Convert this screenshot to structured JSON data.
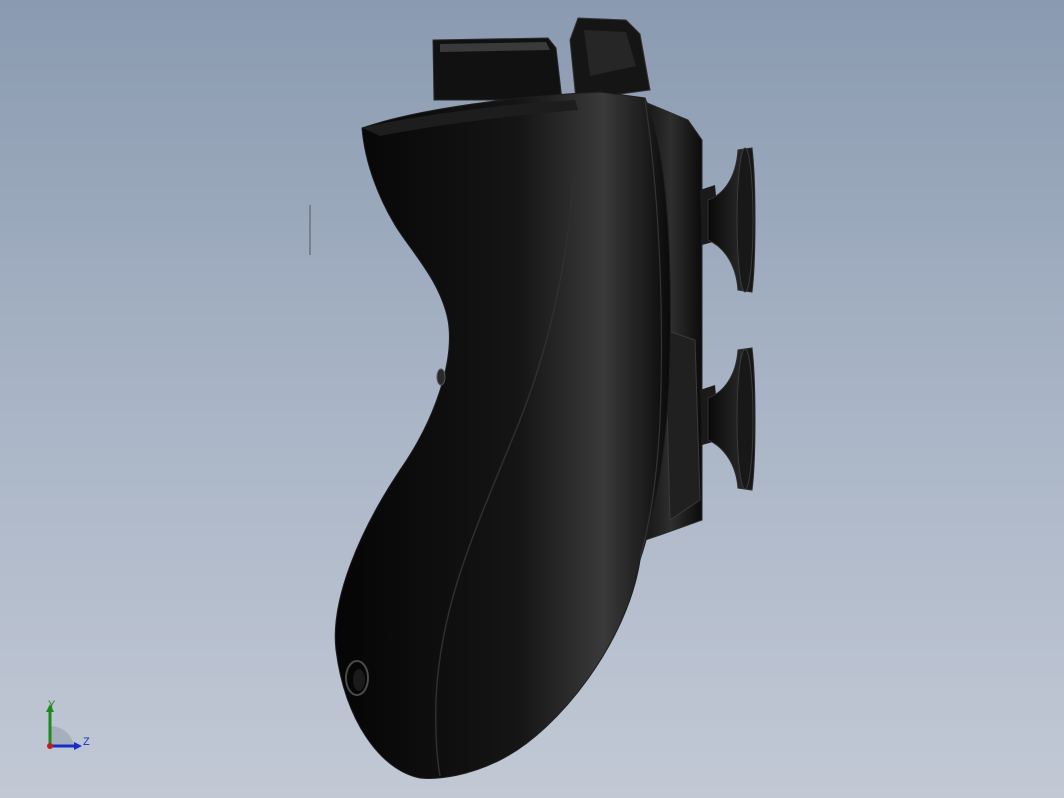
{
  "viewport": {
    "background_top": "#8a9ab0",
    "background_bottom": "#c2c9d5",
    "model_color": "#0b0b0b"
  },
  "triad": {
    "x_axis_color": "#c81a1a",
    "y_axis_color": "#1a8a1a",
    "z_axis_color": "#1a2cc8",
    "y_label": "Y",
    "z_label": "Z"
  }
}
